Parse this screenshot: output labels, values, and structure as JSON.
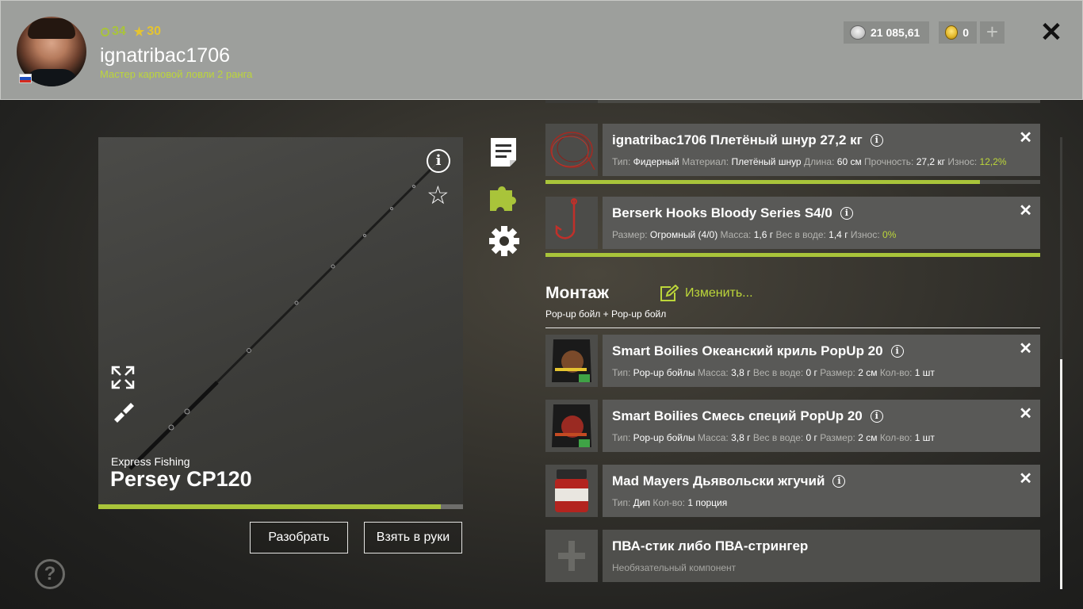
{
  "header": {
    "level": "34",
    "rank": "30",
    "username": "ignatribac1706",
    "title": "Мастер карповой ловли 2 ранга",
    "silver": "21 085,61",
    "gold": "0",
    "plus": "+",
    "close": "✕",
    "flag_colors": [
      "#ffffff",
      "#1f4fbf",
      "#d52b1e"
    ]
  },
  "rod": {
    "brand": "Express Fishing",
    "name": "Persey CP120",
    "condition": 0.94,
    "info": "i",
    "star": "☆",
    "buttons": {
      "disassemble": "Разобрать",
      "take": "Взять в руки"
    }
  },
  "tackle": [
    {
      "title": "ignatribac1706 Плетёный шнур 27,2 кг",
      "props": [
        {
          "k": "Тип:",
          "v": "Фидерный"
        },
        {
          "k": "Материал:",
          "v": "Плетёный шнур"
        },
        {
          "k": "Длина:",
          "v": "60 см"
        },
        {
          "k": "Прочность:",
          "v": "27,2 кг"
        },
        {
          "k": "Износ:",
          "v": "12,2%",
          "green": true
        }
      ],
      "condition": 0.878,
      "icon": "braided-line-icon"
    },
    {
      "title": "Berserk Hooks Bloody Series S4/0",
      "props": [
        {
          "k": "Размер:",
          "v": "Огромный (4/0)"
        },
        {
          "k": "Масса:",
          "v": "1,6 г"
        },
        {
          "k": "Вес в воде:",
          "v": "1,4 г"
        },
        {
          "k": "Износ:",
          "v": "0%",
          "green": true
        }
      ],
      "condition": 1.0,
      "icon": "hook-icon"
    }
  ],
  "assembly": {
    "title": "Монтаж",
    "change": "Изменить...",
    "subtitle": "Pop-up бойл  +  Pop-up бойл"
  },
  "baits": [
    {
      "title": "Smart Boilies Океанский криль PopUp 20",
      "props": [
        {
          "k": "Тип:",
          "v": "Pop-up бойлы"
        },
        {
          "k": "Масса:",
          "v": "3,8 г"
        },
        {
          "k": "Вес в воде:",
          "v": "0 г"
        },
        {
          "k": "Размер:",
          "v": "2 см"
        },
        {
          "k": "Кол-во:",
          "v": "1 шт"
        }
      ],
      "icon": "boilie-bag-icon"
    },
    {
      "title": "Smart Boilies Смесь специй PopUp 20",
      "props": [
        {
          "k": "Тип:",
          "v": "Pop-up бойлы"
        },
        {
          "k": "Масса:",
          "v": "3,8 г"
        },
        {
          "k": "Вес в воде:",
          "v": "0 г"
        },
        {
          "k": "Размер:",
          "v": "2 см"
        },
        {
          "k": "Кол-во:",
          "v": "1 шт"
        }
      ],
      "icon": "boilie-bag-icon"
    },
    {
      "title": "Mad Mayers Дьявольски жгучий",
      "props": [
        {
          "k": "Тип:",
          "v": "Дип"
        },
        {
          "k": "Кол-во:",
          "v": "1 порция"
        }
      ],
      "icon": "dip-jar-icon"
    }
  ],
  "optional_slot": {
    "title": "ПВА-стик либо ПВА-стрингер",
    "subtitle": "Необязательный компонент"
  },
  "help": "?",
  "colors": {
    "accent_green": "#a9c43a",
    "text_green": "#bcd63a",
    "gold": "#e5c430"
  }
}
